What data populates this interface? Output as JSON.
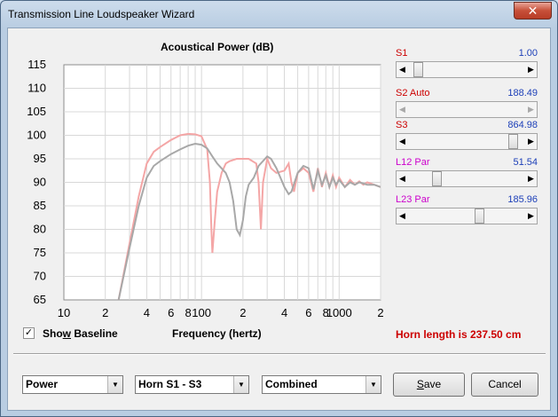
{
  "window": {
    "title": "Transmission Line Loudspeaker Wizard",
    "close_glyph": "✕"
  },
  "chart_data": {
    "type": "line",
    "title": "Acoustical Power (dB)",
    "xlabel": "Frequency (hertz)",
    "ylabel": "",
    "xscale": "log",
    "xlim": [
      10,
      2000
    ],
    "ylim": [
      65,
      115
    ],
    "grid": true,
    "y_ticks": [
      "115",
      "110",
      "105",
      "100",
      "95",
      "90",
      "85",
      "80",
      "75",
      "70",
      "65"
    ],
    "x_ticks": [
      {
        "label": "10",
        "v": 10
      },
      {
        "label": "2",
        "v": 20
      },
      {
        "label": "4",
        "v": 40
      },
      {
        "label": "6",
        "v": 60
      },
      {
        "label": "8",
        "v": 80
      },
      {
        "label": "100",
        "v": 100
      },
      {
        "label": "2",
        "v": 200
      },
      {
        "label": "4",
        "v": 400
      },
      {
        "label": "6",
        "v": 600
      },
      {
        "label": "8",
        "v": 800
      },
      {
        "label": "1000",
        "v": 1000
      },
      {
        "label": "2",
        "v": 2000
      }
    ],
    "series": [
      {
        "color": "#f4a6a6",
        "x": [
          25,
          30,
          35,
          40,
          45,
          50,
          60,
          70,
          80,
          90,
          100,
          110,
          115,
          118,
          120,
          125,
          130,
          140,
          150,
          160,
          180,
          200,
          220,
          250,
          260,
          265,
          270,
          280,
          300,
          320,
          350,
          400,
          430,
          450,
          470,
          500,
          550,
          600,
          650,
          700,
          750,
          800,
          850,
          900,
          950,
          1000,
          1100,
          1200,
          1300,
          1400,
          1500,
          1600,
          1800,
          2000
        ],
        "y": [
          65,
          77,
          87,
          94,
          96.5,
          97.5,
          99,
          100,
          100.3,
          100.2,
          99.8,
          97,
          90,
          80,
          75,
          82,
          88,
          92,
          94,
          94.5,
          95,
          95,
          95,
          94,
          90,
          85,
          80,
          90,
          95,
          93,
          92,
          92.5,
          94,
          90,
          88,
          92,
          93,
          92,
          88,
          93,
          89,
          92,
          89,
          91.5,
          89,
          91,
          89,
          90.5,
          89.5,
          90.2,
          89.5,
          90,
          89.5,
          89
        ]
      },
      {
        "color": "#a8a8a8",
        "x": [
          25,
          30,
          35,
          40,
          45,
          50,
          60,
          70,
          80,
          90,
          100,
          110,
          120,
          130,
          150,
          160,
          170,
          180,
          190,
          200,
          210,
          220,
          240,
          260,
          300,
          320,
          350,
          400,
          430,
          450,
          500,
          550,
          600,
          650,
          700,
          750,
          800,
          850,
          900,
          950,
          1000,
          1100,
          1200,
          1300,
          1400,
          1600,
          1800,
          2000
        ],
        "y": [
          65,
          76,
          85,
          91,
          93.5,
          94.5,
          96,
          97,
          97.8,
          98.2,
          98,
          97.2,
          95.5,
          94,
          92,
          90,
          86,
          80,
          78.8,
          82,
          87,
          89.5,
          91,
          93.5,
          95.5,
          95,
          93,
          89,
          87.5,
          88,
          92,
          93.5,
          93,
          88.5,
          92.5,
          89.5,
          91.5,
          89,
          91,
          89.5,
          90.5,
          89,
          90,
          89.5,
          90,
          89.5,
          89.5,
          89
        ]
      }
    ]
  },
  "sliders": [
    {
      "name": "s1",
      "label": "S1",
      "value": "1.00",
      "label_color": "#cc0000",
      "position": 0.05,
      "left_disabled": false,
      "right_disabled": false
    },
    {
      "name": "s2",
      "label": "S2  Auto",
      "value": "188.49",
      "label_color": "#cc0000",
      "position": null,
      "left_disabled": true,
      "right_disabled": true
    },
    {
      "name": "s3",
      "label": "S3",
      "value": "864.98",
      "label_color": "#cc0000",
      "position": 0.93,
      "left_disabled": false,
      "right_disabled": false
    },
    {
      "name": "l12",
      "label": "L12  Par",
      "value": "51.54",
      "label_color": "#cc00cc",
      "position": 0.22,
      "left_disabled": false,
      "right_disabled": false
    },
    {
      "name": "l23",
      "label": "L23  Par",
      "value": "185.96",
      "label_color": "#cc00cc",
      "position": 0.62,
      "left_disabled": false,
      "right_disabled": false
    }
  ],
  "show_baseline": {
    "label_pre": "Sho",
    "label_key": "w",
    "label_post": " Baseline",
    "checked": true,
    "check_glyph": "✓"
  },
  "horn_length": "Horn length is 237.50 cm",
  "selects": [
    {
      "name": "power",
      "value": "Power"
    },
    {
      "name": "horn",
      "value": "Horn S1 - S3"
    },
    {
      "name": "mode",
      "value": "Combined"
    }
  ],
  "buttons": {
    "save_key": "S",
    "save_rest": "ave",
    "cancel": "Cancel"
  },
  "dropdown_glyph": "▼",
  "arrows": {
    "left": "◀",
    "right": "▶"
  }
}
